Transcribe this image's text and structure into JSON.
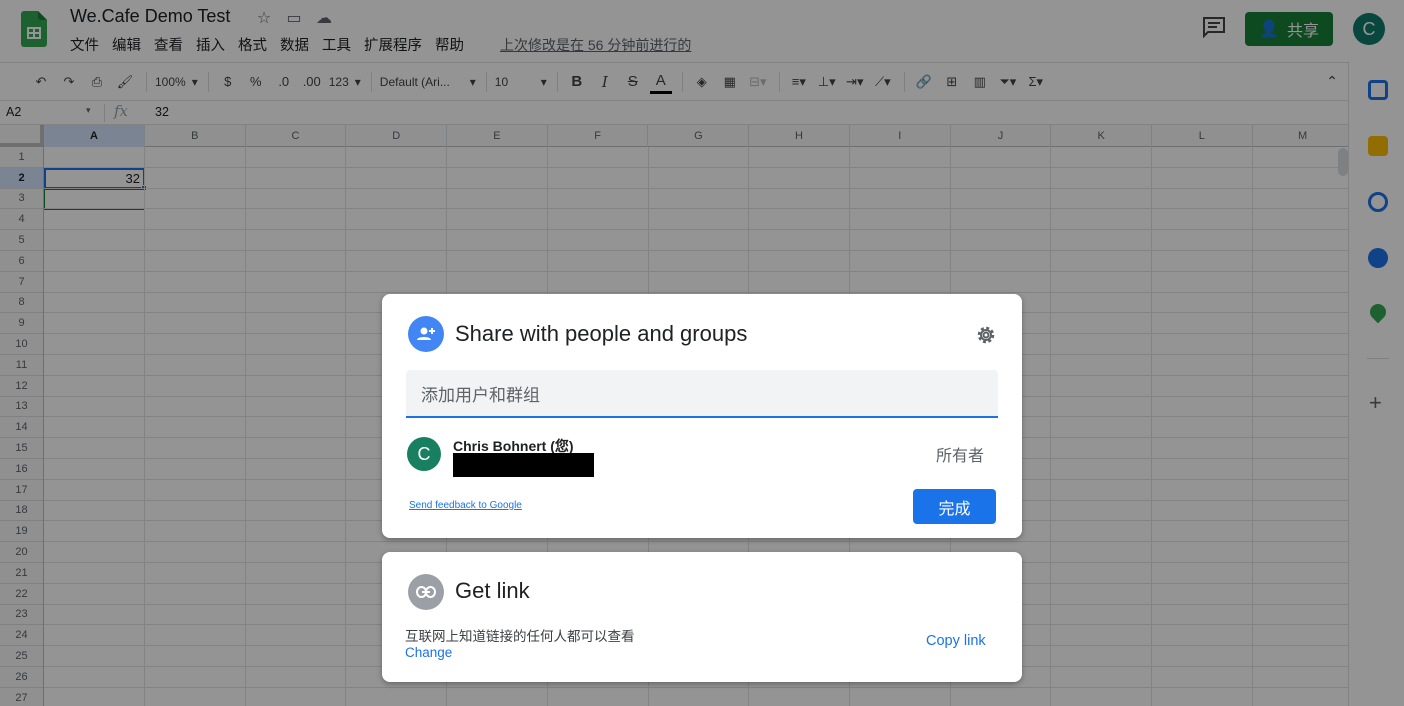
{
  "app": {
    "title": "We.Cafe Demo Test",
    "last_edit": "上次修改是在 56 分钟前进行的",
    "share_label": "共享",
    "user_initial": "C"
  },
  "menu": [
    "文件",
    "编辑",
    "查看",
    "插入",
    "格式",
    "数据",
    "工具",
    "扩展程序",
    "帮助"
  ],
  "toolbar": {
    "zoom": "100%",
    "currency": "$",
    "percent": "%",
    "dec_decrease": ".0",
    "dec_increase": ".00",
    "number_format": "123",
    "font": "Default (Ari...",
    "font_size": "10",
    "bold": "B",
    "italic": "I",
    "strike": "S",
    "text_color": "A"
  },
  "formula_bar": {
    "cell_ref": "A2",
    "fx": "fx",
    "content": "32"
  },
  "columns": [
    "A",
    "B",
    "C",
    "D",
    "E",
    "F",
    "G",
    "H",
    "I",
    "J",
    "K",
    "L",
    "M"
  ],
  "rows": [
    "1",
    "2",
    "3",
    "4",
    "5",
    "6",
    "7",
    "8",
    "9",
    "10",
    "11",
    "12",
    "13",
    "14",
    "15",
    "16",
    "17",
    "18",
    "19",
    "20",
    "21",
    "22",
    "23",
    "24",
    "25",
    "26",
    "27"
  ],
  "cells": {
    "A2": "32"
  },
  "share_dialog": {
    "title": "Share with people and groups",
    "add_placeholder": "添加用户和群组",
    "user_name": "Chris Bohnert (您)",
    "user_initial": "C",
    "role": "所有者",
    "feedback_link": "Send feedback to Google",
    "done_label": "完成"
  },
  "link_dialog": {
    "title": "Get link",
    "description": "互联网上知道链接的任何人都可以查看",
    "change_label": "Change",
    "copy_label": "Copy link"
  },
  "colors": {
    "sheets_green": "#188038",
    "accent_blue": "#1a73e8",
    "avatar_teal": "#0f7b6c"
  }
}
